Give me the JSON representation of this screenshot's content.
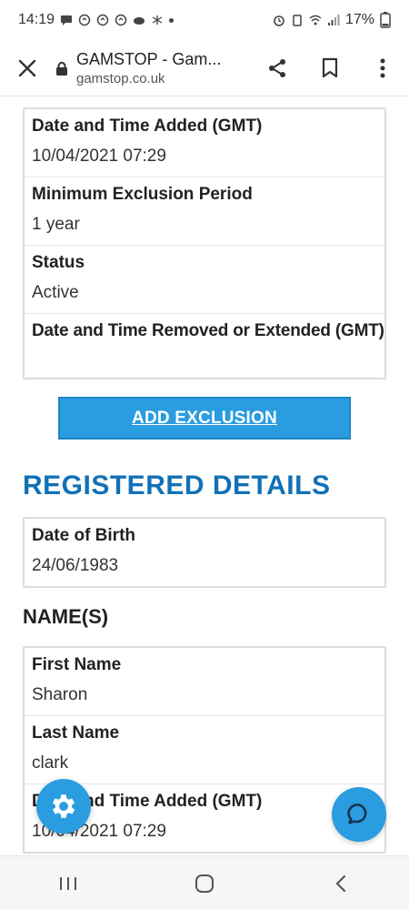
{
  "status_bar": {
    "time": "14:19",
    "battery": "17%"
  },
  "browser": {
    "tab_title": "GAMSTOP - Gam...",
    "domain": "gamstop.co.uk"
  },
  "exclusion_card": {
    "rows": [
      {
        "label": "Date and Time Added (GMT)",
        "value": "10/04/2021 07:29"
      },
      {
        "label": "Minimum Exclusion Period",
        "value": "1 year"
      },
      {
        "label": "Status",
        "value": "Active"
      },
      {
        "label": "Date and Time Removed or Extended (GMT)",
        "value": ""
      }
    ]
  },
  "add_exclusion_label": "ADD EXCLUSION",
  "registered_details": {
    "title": "REGISTERED DETAILS",
    "dob_label": "Date of Birth",
    "dob_value": "24/06/1983"
  },
  "names": {
    "title": "NAME(S)",
    "rows": [
      {
        "label": "First Name",
        "value": "Sharon"
      },
      {
        "label": "Last Name",
        "value": "clark"
      },
      {
        "label": "Date and Time Added (GMT)",
        "value": "10/04/2021 07:29"
      }
    ]
  },
  "colors": {
    "accent": "#2a9ce0",
    "heading": "#1171b6"
  },
  "icons": {
    "close": "close-icon",
    "lock": "lock-icon",
    "share": "share-icon",
    "bookmark": "bookmark-icon",
    "menu": "more-vert-icon",
    "settings": "gear-icon",
    "chat": "chat-icon"
  }
}
